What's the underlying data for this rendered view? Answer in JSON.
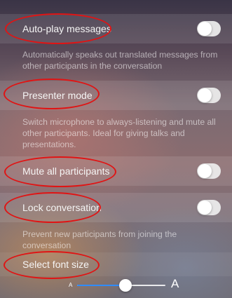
{
  "settings": {
    "auto_play": {
      "label": "Auto-play messages",
      "on": false,
      "description": "Automatically speaks out translated messages from other participants in the conversation"
    },
    "presenter": {
      "label": "Presenter mode",
      "on": false,
      "description": "Switch microphone to always-listening and mute all other participants. Ideal for giving talks and presentations."
    },
    "mute_all": {
      "label": "Mute all participants",
      "on": false
    },
    "lock": {
      "label": "Lock conversation",
      "on": false,
      "description": "Prevent new participants from joining the conversation"
    }
  },
  "font_size": {
    "label": "Select font size",
    "small_label": "A",
    "large_label": "A",
    "value_fraction": 0.55
  },
  "colors": {
    "annotation": "#e01414",
    "slider_accent": "#2f8cff",
    "toggle_off": "#ebebeb"
  }
}
